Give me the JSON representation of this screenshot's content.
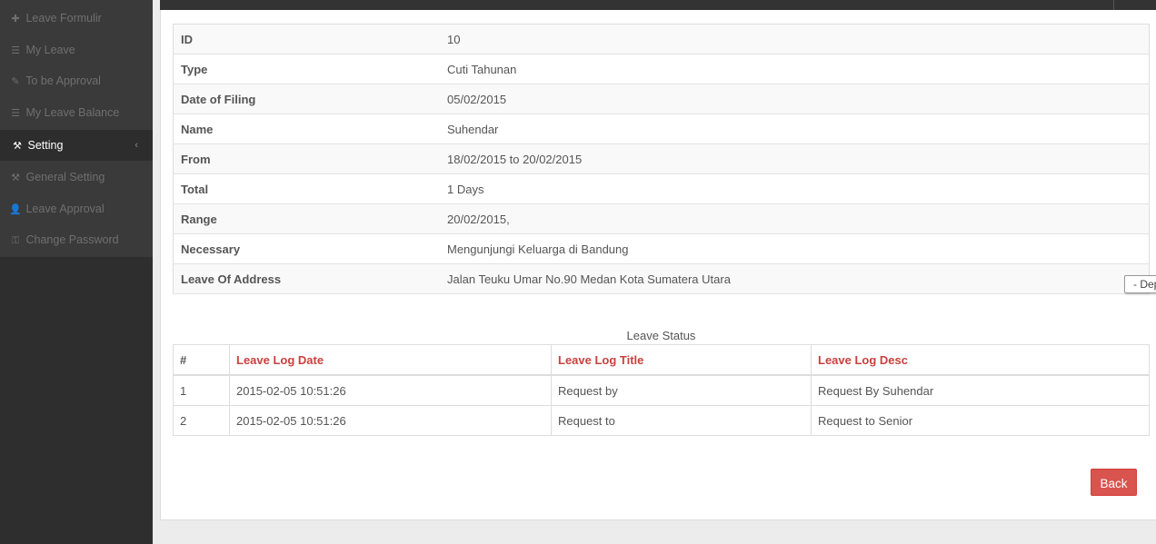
{
  "sidebar": {
    "items": [
      {
        "icon": "plus-icon",
        "glyph": "✚",
        "label": "Leave Formulir"
      },
      {
        "icon": "list-icon",
        "glyph": "☰",
        "label": "My Leave"
      },
      {
        "icon": "pencil-icon",
        "glyph": "✎",
        "label": "To be Approval"
      },
      {
        "icon": "list-icon",
        "glyph": "☰",
        "label": "My Leave Balance"
      },
      {
        "icon": "wrench-icon",
        "glyph": "⚒",
        "label": "Setting",
        "caret": "‹"
      },
      {
        "icon": "wrench-icon",
        "glyph": "⚒",
        "label": "General Setting"
      },
      {
        "icon": "user-icon",
        "glyph": "👤",
        "label": "Leave Approval"
      },
      {
        "icon": "key-icon",
        "glyph": "⚿",
        "label": "Change Password"
      }
    ]
  },
  "detail": {
    "rows": [
      {
        "label": "ID",
        "value": "10"
      },
      {
        "label": "Type",
        "value": "Cuti Tahunan"
      },
      {
        "label": "Date of Filing",
        "value": "05/02/2015"
      },
      {
        "label": "Name",
        "value": "Suhendar"
      },
      {
        "label": "From",
        "value": "18/02/2015 to 20/02/2015"
      },
      {
        "label": "Total",
        "value": "1 Days"
      },
      {
        "label": "Range",
        "value": "20/02/2015,"
      },
      {
        "label": "Necessary",
        "value": "Mengunjungi Keluarga di Bandung"
      },
      {
        "label": "Leave Of Address",
        "value": "Jalan Teuku Umar No.90 Medan Kota Sumatera Utara"
      }
    ]
  },
  "tooltip": "- Depa",
  "log": {
    "caption": "Leave Status",
    "headers": [
      "#",
      "Leave Log Date",
      "Leave Log Title",
      "Leave Log Desc"
    ],
    "rows": [
      [
        "1",
        "2015-02-05 10:51:26",
        "Request by",
        "Request By Suhendar"
      ],
      [
        "2",
        "2015-02-05 10:51:26",
        "Request to",
        "Request to Senior"
      ]
    ]
  },
  "actions": {
    "back_label": "Back"
  },
  "colors": {
    "accent": "#c9413f",
    "button": "#d9534f",
    "sidebar_bg": "#3a3a3a"
  }
}
